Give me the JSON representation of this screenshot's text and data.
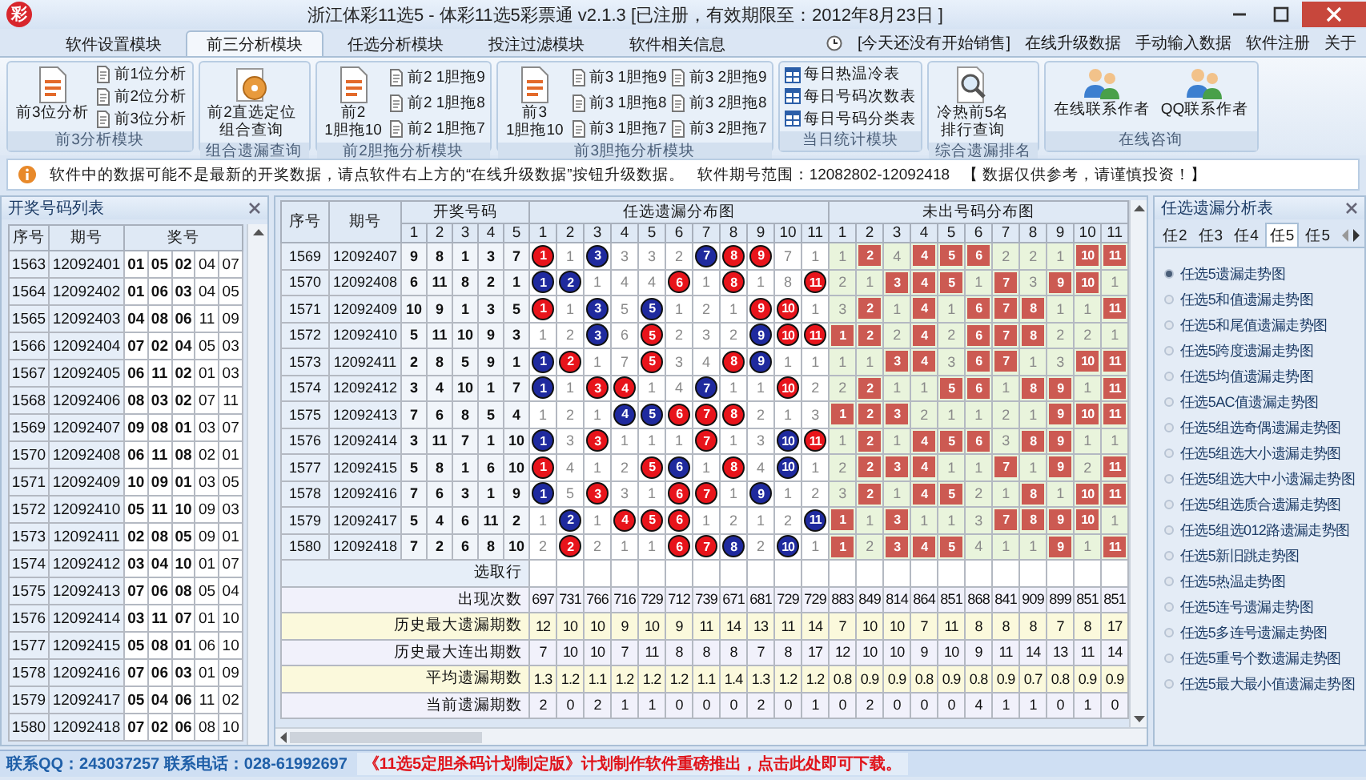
{
  "window": {
    "logo": "彩",
    "title": "浙江体彩11选5 - 体彩11选5彩票通 v2.1.3 [已注册，有效期限至：2012年8月23日 ]"
  },
  "menu_tabs": [
    {
      "label": "软件设置模块",
      "selected": false
    },
    {
      "label": "前三分析模块",
      "selected": true
    },
    {
      "label": "任选分析模块",
      "selected": false
    },
    {
      "label": "投注过滤模块",
      "selected": false
    },
    {
      "label": "软件相关信息",
      "selected": false
    }
  ],
  "sales_notice": "[今天还没有开始销售]",
  "menu_links": [
    "在线升级数据",
    "手动输入数据",
    "软件注册",
    "关于"
  ],
  "ribbon_groups": [
    {
      "title": "前3分析模块",
      "large": [
        {
          "lines": [
            "前3位分析"
          ]
        }
      ],
      "small": [
        [
          "前1位分析",
          "前2位分析",
          "前3位分析"
        ]
      ]
    },
    {
      "title": "组合遗漏查询",
      "large": [
        {
          "lines": [
            "前2直选定位",
            "组合查询"
          ]
        }
      ]
    },
    {
      "title": "前2胆拖分析模块",
      "large": [
        {
          "lines": [
            "前2",
            "1胆拖10"
          ]
        }
      ],
      "small": [
        [
          "前2 1胆拖9",
          "前2 1胆拖8",
          "前2 1胆拖7"
        ]
      ]
    },
    {
      "title": "前3胆拖分析模块",
      "large": [
        {
          "lines": [
            "前3",
            "1胆拖10"
          ]
        }
      ],
      "small": [
        [
          "前3 1胆拖9",
          "前3 1胆拖8",
          "前3 1胆拖7"
        ],
        [
          "前3 2胆拖9",
          "前3 2胆拖8",
          "前3 2胆拖7"
        ]
      ]
    },
    {
      "title": "当日统计模块",
      "small": [
        [
          "每日热温冷表",
          "每日号码次数表",
          "每日号码分类表"
        ]
      ]
    },
    {
      "title": "综合遗漏排名",
      "large": [
        {
          "lines": [
            "冷热前5名",
            "排行查询"
          ]
        }
      ]
    },
    {
      "title": "在线咨询",
      "large": [
        {
          "lines": [
            "在线联系作者"
          ]
        },
        {
          "lines": [
            "QQ联系作者"
          ]
        }
      ]
    }
  ],
  "info_bar": {
    "message": "软件中的数据可能不是最新的开奖数据，请点软件右上方的“在线升级数据”按钮升级数据。",
    "range": "软件期号范围：12082802-12092418",
    "disclaimer": "【 数据仅供参考，请谨慎投资！】"
  },
  "draw_list": {
    "title": "开奖号码列表",
    "columns": [
      "序号",
      "期号",
      "奖号"
    ],
    "rows": [
      {
        "seq": "1563",
        "issue": "12092401",
        "numbers": [
          "01",
          "05",
          "02",
          "04",
          "07"
        ]
      },
      {
        "seq": "1564",
        "issue": "12092402",
        "numbers": [
          "01",
          "06",
          "03",
          "04",
          "05"
        ]
      },
      {
        "seq": "1565",
        "issue": "12092403",
        "numbers": [
          "04",
          "08",
          "06",
          "11",
          "09"
        ]
      },
      {
        "seq": "1566",
        "issue": "12092404",
        "numbers": [
          "07",
          "02",
          "04",
          "05",
          "03"
        ]
      },
      {
        "seq": "1567",
        "issue": "12092405",
        "numbers": [
          "06",
          "11",
          "02",
          "01",
          "03"
        ]
      },
      {
        "seq": "1568",
        "issue": "12092406",
        "numbers": [
          "08",
          "03",
          "02",
          "07",
          "11"
        ]
      },
      {
        "seq": "1569",
        "issue": "12092407",
        "numbers": [
          "09",
          "08",
          "01",
          "03",
          "07"
        ]
      },
      {
        "seq": "1570",
        "issue": "12092408",
        "numbers": [
          "06",
          "11",
          "08",
          "02",
          "01"
        ]
      },
      {
        "seq": "1571",
        "issue": "12092409",
        "numbers": [
          "10",
          "09",
          "01",
          "03",
          "05"
        ]
      },
      {
        "seq": "1572",
        "issue": "12092410",
        "numbers": [
          "05",
          "11",
          "10",
          "09",
          "03"
        ]
      },
      {
        "seq": "1573",
        "issue": "12092411",
        "numbers": [
          "02",
          "08",
          "05",
          "09",
          "01"
        ]
      },
      {
        "seq": "1574",
        "issue": "12092412",
        "numbers": [
          "03",
          "04",
          "10",
          "01",
          "07"
        ]
      },
      {
        "seq": "1575",
        "issue": "12092413",
        "numbers": [
          "07",
          "06",
          "08",
          "05",
          "04"
        ]
      },
      {
        "seq": "1576",
        "issue": "12092414",
        "numbers": [
          "03",
          "11",
          "07",
          "01",
          "10"
        ]
      },
      {
        "seq": "1577",
        "issue": "12092415",
        "numbers": [
          "05",
          "08",
          "01",
          "06",
          "10"
        ]
      },
      {
        "seq": "1578",
        "issue": "12092416",
        "numbers": [
          "07",
          "06",
          "03",
          "01",
          "09"
        ]
      },
      {
        "seq": "1579",
        "issue": "12092417",
        "numbers": [
          "05",
          "04",
          "06",
          "11",
          "02"
        ]
      },
      {
        "seq": "1580",
        "issue": "12092418",
        "numbers": [
          "07",
          "02",
          "06",
          "08",
          "10"
        ]
      }
    ]
  },
  "main_table": {
    "seq_header": "序号",
    "issue_header": "期号",
    "group_headers": [
      "开奖号码",
      "任选遗漏分布图",
      "未出号码分布图"
    ],
    "draw_columns": [
      "1",
      "2",
      "3",
      "4",
      "5"
    ],
    "pick_columns": [
      "1",
      "2",
      "3",
      "4",
      "5",
      "6",
      "7",
      "8",
      "9",
      "10",
      "11"
    ],
    "miss_columns": [
      "1",
      "2",
      "3",
      "4",
      "5",
      "6",
      "7",
      "8",
      "9",
      "10",
      "11"
    ],
    "rows": [
      {
        "seq": "1569",
        "issue": "12092407",
        "draw": [
          "9",
          "8",
          "1",
          "3",
          "7"
        ],
        "pick": [
          {
            "v": "1",
            "color": "#e8141b"
          },
          {
            "v": "1"
          },
          {
            "v": "3",
            "color": "#1f2a9e"
          },
          {
            "v": "3"
          },
          {
            "v": "3"
          },
          {
            "v": "2"
          },
          {
            "v": "7",
            "color": "#1f2a9e"
          },
          {
            "v": "8",
            "color": "#e8141b"
          },
          {
            "v": "9",
            "color": "#e8141b"
          },
          {
            "v": "7"
          },
          {
            "v": "1"
          }
        ],
        "miss": [
          {
            "v": "1",
            "boxed": false
          },
          {
            "v": "2",
            "boxed": true
          },
          {
            "v": "4",
            "boxed": false
          },
          {
            "v": "4",
            "boxed": true
          },
          {
            "v": "5",
            "boxed": true
          },
          {
            "v": "6",
            "boxed": true
          },
          {
            "v": "2",
            "boxed": false
          },
          {
            "v": "2",
            "boxed": false
          },
          {
            "v": "1",
            "boxed": false
          },
          {
            "v": "10",
            "boxed": true
          },
          {
            "v": "11",
            "boxed": true
          }
        ]
      },
      {
        "seq": "1570",
        "issue": "12092408",
        "draw": [
          "6",
          "11",
          "8",
          "2",
          "1"
        ],
        "pick": [
          {
            "v": "1",
            "color": "#1f2a9e"
          },
          {
            "v": "2",
            "color": "#1f2a9e"
          },
          {
            "v": "1"
          },
          {
            "v": "4"
          },
          {
            "v": "4"
          },
          {
            "v": "6",
            "color": "#e8141b"
          },
          {
            "v": "1"
          },
          {
            "v": "8",
            "color": "#e8141b"
          },
          {
            "v": "1"
          },
          {
            "v": "8"
          },
          {
            "v": "11",
            "color": "#e8141b"
          }
        ],
        "miss": [
          {
            "v": "2",
            "boxed": false
          },
          {
            "v": "1",
            "boxed": false
          },
          {
            "v": "3",
            "boxed": true
          },
          {
            "v": "4",
            "boxed": true
          },
          {
            "v": "5",
            "boxed": true
          },
          {
            "v": "1",
            "boxed": false
          },
          {
            "v": "7",
            "boxed": true
          },
          {
            "v": "3",
            "boxed": false
          },
          {
            "v": "9",
            "boxed": true
          },
          {
            "v": "10",
            "boxed": true
          },
          {
            "v": "1",
            "boxed": false
          }
        ]
      },
      {
        "seq": "1571",
        "issue": "12092409",
        "draw": [
          "10",
          "9",
          "1",
          "3",
          "5"
        ],
        "pick": [
          {
            "v": "1",
            "color": "#e8141b"
          },
          {
            "v": "1"
          },
          {
            "v": "3",
            "color": "#1f2a9e"
          },
          {
            "v": "5"
          },
          {
            "v": "5",
            "color": "#1f2a9e"
          },
          {
            "v": "1"
          },
          {
            "v": "2"
          },
          {
            "v": "1"
          },
          {
            "v": "9",
            "color": "#e8141b"
          },
          {
            "v": "10",
            "color": "#e8141b"
          },
          {
            "v": "1"
          }
        ],
        "miss": [
          {
            "v": "3",
            "boxed": false
          },
          {
            "v": "2",
            "boxed": true
          },
          {
            "v": "1",
            "boxed": false
          },
          {
            "v": "4",
            "boxed": true
          },
          {
            "v": "1",
            "boxed": false
          },
          {
            "v": "6",
            "boxed": true
          },
          {
            "v": "7",
            "boxed": true
          },
          {
            "v": "8",
            "boxed": true
          },
          {
            "v": "1",
            "boxed": false
          },
          {
            "v": "1",
            "boxed": false
          },
          {
            "v": "11",
            "boxed": true
          }
        ]
      },
      {
        "seq": "1572",
        "issue": "12092410",
        "draw": [
          "5",
          "11",
          "10",
          "9",
          "3"
        ],
        "pick": [
          {
            "v": "1"
          },
          {
            "v": "2"
          },
          {
            "v": "3",
            "color": "#1f2a9e"
          },
          {
            "v": "6"
          },
          {
            "v": "5",
            "color": "#e8141b"
          },
          {
            "v": "2"
          },
          {
            "v": "3"
          },
          {
            "v": "2"
          },
          {
            "v": "9",
            "color": "#1f2a9e"
          },
          {
            "v": "10",
            "color": "#e8141b"
          },
          {
            "v": "11",
            "color": "#e8141b"
          }
        ],
        "miss": [
          {
            "v": "1",
            "boxed": true
          },
          {
            "v": "2",
            "boxed": true
          },
          {
            "v": "2",
            "boxed": false
          },
          {
            "v": "4",
            "boxed": true
          },
          {
            "v": "2",
            "boxed": false
          },
          {
            "v": "6",
            "boxed": true
          },
          {
            "v": "7",
            "boxed": true
          },
          {
            "v": "8",
            "boxed": true
          },
          {
            "v": "2",
            "boxed": false
          },
          {
            "v": "2",
            "boxed": false
          },
          {
            "v": "1",
            "boxed": false
          }
        ]
      },
      {
        "seq": "1573",
        "issue": "12092411",
        "draw": [
          "2",
          "8",
          "5",
          "9",
          "1"
        ],
        "pick": [
          {
            "v": "1",
            "color": "#1f2a9e"
          },
          {
            "v": "2",
            "color": "#e8141b"
          },
          {
            "v": "1"
          },
          {
            "v": "7"
          },
          {
            "v": "5",
            "color": "#e8141b"
          },
          {
            "v": "3"
          },
          {
            "v": "4"
          },
          {
            "v": "8",
            "color": "#e8141b"
          },
          {
            "v": "9",
            "color": "#1f2a9e"
          },
          {
            "v": "1"
          },
          {
            "v": "1"
          }
        ],
        "miss": [
          {
            "v": "1",
            "boxed": false
          },
          {
            "v": "1",
            "boxed": false
          },
          {
            "v": "3",
            "boxed": true
          },
          {
            "v": "4",
            "boxed": true
          },
          {
            "v": "3",
            "boxed": false
          },
          {
            "v": "6",
            "boxed": true
          },
          {
            "v": "7",
            "boxed": true
          },
          {
            "v": "1",
            "boxed": false
          },
          {
            "v": "3",
            "boxed": false
          },
          {
            "v": "10",
            "boxed": true
          },
          {
            "v": "11",
            "boxed": true
          }
        ]
      },
      {
        "seq": "1574",
        "issue": "12092412",
        "draw": [
          "3",
          "4",
          "10",
          "1",
          "7"
        ],
        "pick": [
          {
            "v": "1",
            "color": "#1f2a9e"
          },
          {
            "v": "1"
          },
          {
            "v": "3",
            "color": "#e8141b"
          },
          {
            "v": "4",
            "color": "#e8141b"
          },
          {
            "v": "1"
          },
          {
            "v": "4"
          },
          {
            "v": "7",
            "color": "#1f2a9e"
          },
          {
            "v": "1"
          },
          {
            "v": "1"
          },
          {
            "v": "10",
            "color": "#e8141b"
          },
          {
            "v": "2"
          }
        ],
        "miss": [
          {
            "v": "2",
            "boxed": false
          },
          {
            "v": "2",
            "boxed": true
          },
          {
            "v": "1",
            "boxed": false
          },
          {
            "v": "1",
            "boxed": false
          },
          {
            "v": "5",
            "boxed": true
          },
          {
            "v": "6",
            "boxed": true
          },
          {
            "v": "1",
            "boxed": false
          },
          {
            "v": "8",
            "boxed": true
          },
          {
            "v": "9",
            "boxed": true
          },
          {
            "v": "1",
            "boxed": false
          },
          {
            "v": "11",
            "boxed": true
          }
        ]
      },
      {
        "seq": "1575",
        "issue": "12092413",
        "draw": [
          "7",
          "6",
          "8",
          "5",
          "4"
        ],
        "pick": [
          {
            "v": "1"
          },
          {
            "v": "2"
          },
          {
            "v": "1"
          },
          {
            "v": "4",
            "color": "#1f2a9e"
          },
          {
            "v": "5",
            "color": "#1f2a9e"
          },
          {
            "v": "6",
            "color": "#e8141b"
          },
          {
            "v": "7",
            "color": "#e8141b"
          },
          {
            "v": "8",
            "color": "#e8141b"
          },
          {
            "v": "2"
          },
          {
            "v": "1"
          },
          {
            "v": "3"
          }
        ],
        "miss": [
          {
            "v": "1",
            "boxed": true
          },
          {
            "v": "2",
            "boxed": true
          },
          {
            "v": "3",
            "boxed": true
          },
          {
            "v": "2",
            "boxed": false
          },
          {
            "v": "1",
            "boxed": false
          },
          {
            "v": "1",
            "boxed": false
          },
          {
            "v": "2",
            "boxed": false
          },
          {
            "v": "1",
            "boxed": false
          },
          {
            "v": "9",
            "boxed": true
          },
          {
            "v": "10",
            "boxed": true
          },
          {
            "v": "11",
            "boxed": true
          }
        ]
      },
      {
        "seq": "1576",
        "issue": "12092414",
        "draw": [
          "3",
          "11",
          "7",
          "1",
          "10"
        ],
        "pick": [
          {
            "v": "1",
            "color": "#1f2a9e"
          },
          {
            "v": "3"
          },
          {
            "v": "3",
            "color": "#e8141b"
          },
          {
            "v": "1"
          },
          {
            "v": "1"
          },
          {
            "v": "1"
          },
          {
            "v": "7",
            "color": "#e8141b"
          },
          {
            "v": "1"
          },
          {
            "v": "3"
          },
          {
            "v": "10",
            "color": "#1f2a9e"
          },
          {
            "v": "11",
            "color": "#e8141b"
          }
        ],
        "miss": [
          {
            "v": "1",
            "boxed": false
          },
          {
            "v": "2",
            "boxed": true
          },
          {
            "v": "1",
            "boxed": false
          },
          {
            "v": "4",
            "boxed": true
          },
          {
            "v": "5",
            "boxed": true
          },
          {
            "v": "6",
            "boxed": true
          },
          {
            "v": "3",
            "boxed": false
          },
          {
            "v": "8",
            "boxed": true
          },
          {
            "v": "9",
            "boxed": true
          },
          {
            "v": "1",
            "boxed": false
          },
          {
            "v": "1",
            "boxed": false
          }
        ]
      },
      {
        "seq": "1577",
        "issue": "12092415",
        "draw": [
          "5",
          "8",
          "1",
          "6",
          "10"
        ],
        "pick": [
          {
            "v": "1",
            "color": "#e8141b"
          },
          {
            "v": "4"
          },
          {
            "v": "1"
          },
          {
            "v": "2"
          },
          {
            "v": "5",
            "color": "#e8141b"
          },
          {
            "v": "6",
            "color": "#1f2a9e"
          },
          {
            "v": "1"
          },
          {
            "v": "8",
            "color": "#e8141b"
          },
          {
            "v": "4"
          },
          {
            "v": "10",
            "color": "#1f2a9e"
          },
          {
            "v": "1"
          }
        ],
        "miss": [
          {
            "v": "2",
            "boxed": false
          },
          {
            "v": "2",
            "boxed": true
          },
          {
            "v": "3",
            "boxed": true
          },
          {
            "v": "4",
            "boxed": true
          },
          {
            "v": "1",
            "boxed": false
          },
          {
            "v": "1",
            "boxed": false
          },
          {
            "v": "7",
            "boxed": true
          },
          {
            "v": "1",
            "boxed": false
          },
          {
            "v": "9",
            "boxed": true
          },
          {
            "v": "2",
            "boxed": false
          },
          {
            "v": "11",
            "boxed": true
          }
        ]
      },
      {
        "seq": "1578",
        "issue": "12092416",
        "draw": [
          "7",
          "6",
          "3",
          "1",
          "9"
        ],
        "pick": [
          {
            "v": "1",
            "color": "#1f2a9e"
          },
          {
            "v": "5"
          },
          {
            "v": "3",
            "color": "#e8141b"
          },
          {
            "v": "3"
          },
          {
            "v": "1"
          },
          {
            "v": "6",
            "color": "#e8141b"
          },
          {
            "v": "7",
            "color": "#e8141b"
          },
          {
            "v": "1"
          },
          {
            "v": "9",
            "color": "#1f2a9e"
          },
          {
            "v": "1"
          },
          {
            "v": "2"
          }
        ],
        "miss": [
          {
            "v": "3",
            "boxed": false
          },
          {
            "v": "2",
            "boxed": true
          },
          {
            "v": "1",
            "boxed": false
          },
          {
            "v": "4",
            "boxed": true
          },
          {
            "v": "5",
            "boxed": true
          },
          {
            "v": "2",
            "boxed": false
          },
          {
            "v": "1",
            "boxed": false
          },
          {
            "v": "8",
            "boxed": true
          },
          {
            "v": "1",
            "boxed": false
          },
          {
            "v": "10",
            "boxed": true
          },
          {
            "v": "11",
            "boxed": true
          }
        ]
      },
      {
        "seq": "1579",
        "issue": "12092417",
        "draw": [
          "5",
          "4",
          "6",
          "11",
          "2"
        ],
        "pick": [
          {
            "v": "1"
          },
          {
            "v": "2",
            "color": "#1f2a9e"
          },
          {
            "v": "1"
          },
          {
            "v": "4",
            "color": "#e8141b"
          },
          {
            "v": "5",
            "color": "#e8141b"
          },
          {
            "v": "6",
            "color": "#e8141b"
          },
          {
            "v": "1"
          },
          {
            "v": "2"
          },
          {
            "v": "1"
          },
          {
            "v": "2"
          },
          {
            "v": "11",
            "color": "#1f2a9e"
          }
        ],
        "miss": [
          {
            "v": "1",
            "boxed": true
          },
          {
            "v": "1",
            "boxed": false
          },
          {
            "v": "3",
            "boxed": true
          },
          {
            "v": "1",
            "boxed": false
          },
          {
            "v": "1",
            "boxed": false
          },
          {
            "v": "3",
            "boxed": false
          },
          {
            "v": "7",
            "boxed": true
          },
          {
            "v": "8",
            "boxed": true
          },
          {
            "v": "9",
            "boxed": true
          },
          {
            "v": "10",
            "boxed": true
          },
          {
            "v": "1",
            "boxed": false
          }
        ]
      },
      {
        "seq": "1580",
        "issue": "12092418",
        "draw": [
          "7",
          "2",
          "6",
          "8",
          "10"
        ],
        "pick": [
          {
            "v": "2"
          },
          {
            "v": "2",
            "color": "#e8141b"
          },
          {
            "v": "2"
          },
          {
            "v": "1"
          },
          {
            "v": "1"
          },
          {
            "v": "6",
            "color": "#e8141b"
          },
          {
            "v": "7",
            "color": "#e8141b"
          },
          {
            "v": "8",
            "color": "#1f2a9e"
          },
          {
            "v": "2"
          },
          {
            "v": "10",
            "color": "#1f2a9e"
          },
          {
            "v": "1"
          }
        ],
        "miss": [
          {
            "v": "1",
            "boxed": true
          },
          {
            "v": "2",
            "boxed": false
          },
          {
            "v": "3",
            "boxed": true
          },
          {
            "v": "4",
            "boxed": true
          },
          {
            "v": "5",
            "boxed": true
          },
          {
            "v": "4",
            "boxed": false
          },
          {
            "v": "1",
            "boxed": false
          },
          {
            "v": "1",
            "boxed": false
          },
          {
            "v": "9",
            "boxed": true
          },
          {
            "v": "1",
            "boxed": false
          },
          {
            "v": "11",
            "boxed": true
          }
        ]
      }
    ],
    "select_row_label": "选取行",
    "stats": [
      {
        "label": "出现次数",
        "values": [
          "697",
          "731",
          "766",
          "716",
          "729",
          "712",
          "739",
          "671",
          "681",
          "729",
          "729",
          "883",
          "849",
          "814",
          "864",
          "851",
          "868",
          "841",
          "909",
          "899",
          "851",
          "851"
        ]
      },
      {
        "label": "历史最大遗漏期数",
        "values": [
          "12",
          "10",
          "10",
          "9",
          "10",
          "9",
          "11",
          "14",
          "13",
          "11",
          "14",
          "7",
          "10",
          "10",
          "7",
          "11",
          "8",
          "8",
          "8",
          "7",
          "8",
          "17"
        ]
      },
      {
        "label": "历史最大连出期数",
        "values": [
          "7",
          "10",
          "10",
          "7",
          "11",
          "8",
          "8",
          "8",
          "7",
          "8",
          "17",
          "12",
          "10",
          "10",
          "9",
          "10",
          "9",
          "11",
          "14",
          "13",
          "11",
          "14"
        ]
      },
      {
        "label": "平均遗漏期数",
        "values": [
          "1.3",
          "1.2",
          "1.1",
          "1.2",
          "1.2",
          "1.2",
          "1.1",
          "1.4",
          "1.3",
          "1.2",
          "1.2",
          "0.8",
          "0.9",
          "0.9",
          "0.8",
          "0.9",
          "0.8",
          "0.9",
          "0.7",
          "0.8",
          "0.9",
          "0.9"
        ]
      },
      {
        "label": "当前遗漏期数",
        "values": [
          "2",
          "0",
          "2",
          "1",
          "1",
          "0",
          "0",
          "0",
          "2",
          "0",
          "1",
          "0",
          "2",
          "0",
          "0",
          "0",
          "4",
          "1",
          "1",
          "0",
          "1",
          "0"
        ]
      }
    ]
  },
  "side_panel": {
    "title": "任选遗漏分析表",
    "tabs": [
      {
        "label": "任2",
        "selected": false
      },
      {
        "label": "任3",
        "selected": false
      },
      {
        "label": "任4",
        "selected": false
      },
      {
        "label": "任5",
        "selected": true
      },
      {
        "label": "任5",
        "selected": false
      }
    ],
    "options": [
      {
        "label": "任选5遗漏走势图",
        "selected": true
      },
      {
        "label": "任选5和值遗漏走势图",
        "selected": false
      },
      {
        "label": "任选5和尾值遗漏走势图",
        "selected": false
      },
      {
        "label": "任选5跨度遗漏走势图",
        "selected": false
      },
      {
        "label": "任选5均值遗漏走势图",
        "selected": false
      },
      {
        "label": "任选5AC值遗漏走势图",
        "selected": false
      },
      {
        "label": "任选5组选奇偶遗漏走势图",
        "selected": false
      },
      {
        "label": "任选5组选大小遗漏走势图",
        "selected": false
      },
      {
        "label": "任选5组选大中小遗漏走势图",
        "selected": false
      },
      {
        "label": "任选5组选质合遗漏走势图",
        "selected": false
      },
      {
        "label": "任选5组选012路遗漏走势图",
        "selected": false
      },
      {
        "label": "任选5新旧跳走势图",
        "selected": false
      },
      {
        "label": "任选5热温走势图",
        "selected": false
      },
      {
        "label": "任选5连号遗漏走势图",
        "selected": false
      },
      {
        "label": "任选5多连号遗漏走势图",
        "selected": false
      },
      {
        "label": "任选5重号个数遗漏走势图",
        "selected": false
      },
      {
        "label": "任选5最大最小值遗漏走势图",
        "selected": false
      }
    ]
  },
  "status_bar": {
    "contact": "联系QQ：243037257 联系电话：028-61992697",
    "promo": "《11选5定胆杀码计划制定版》计划制作软件重磅推出，点击此处即可下载。"
  }
}
